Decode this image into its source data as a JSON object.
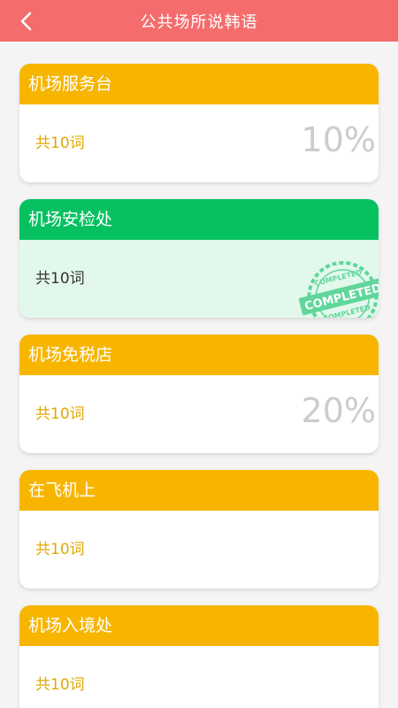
{
  "header": {
    "title": "公共场所说韩语"
  },
  "colors": {
    "header": "#f56c6c",
    "yellow": "#f7b500",
    "green": "#07c160"
  },
  "cards": [
    {
      "title": "机场服务台",
      "count": "共10词",
      "percent": "10%",
      "status": "in-progress"
    },
    {
      "title": "机场安检处",
      "count": "共10词",
      "status": "completed",
      "stamp_text": "COMPLETED"
    },
    {
      "title": "机场免税店",
      "count": "共10词",
      "percent": "20%",
      "status": "in-progress"
    },
    {
      "title": "在飞机上",
      "count": "共10词",
      "status": "not-started"
    },
    {
      "title": "机场入境处",
      "count": "共10词",
      "status": "not-started"
    }
  ]
}
